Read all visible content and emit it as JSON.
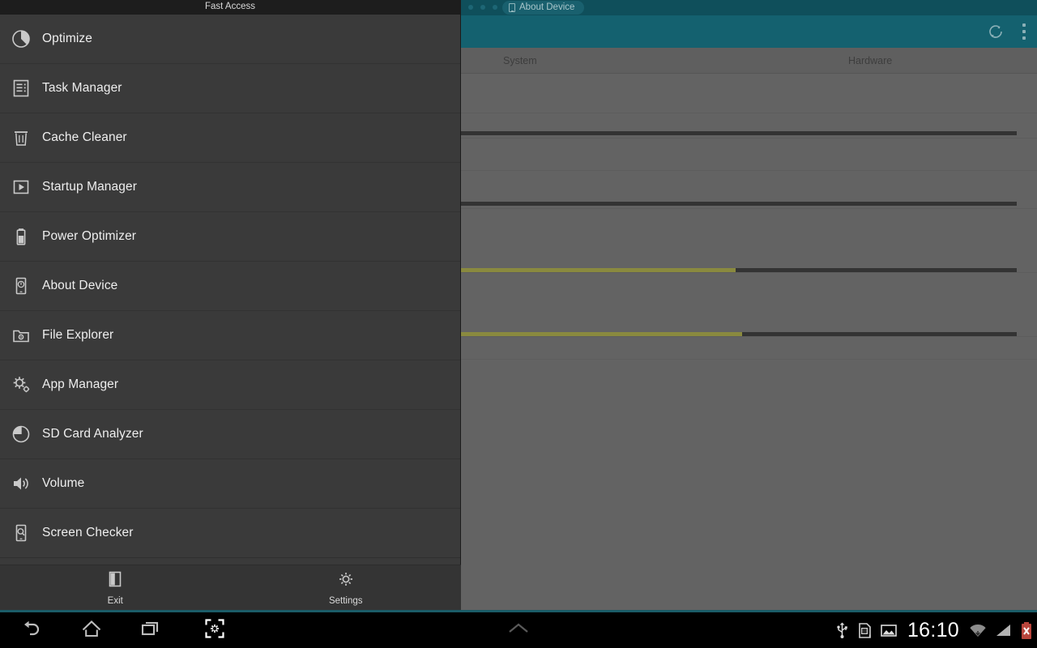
{
  "app": {
    "window_tab": {
      "label": "About Device",
      "icon": "phone-icon"
    },
    "actionbar": {
      "refresh_icon": "refresh-icon",
      "overflow_icon": "overflow-menu-icon"
    },
    "tabs": [
      {
        "label": "System",
        "selected": true
      },
      {
        "label": "Hardware",
        "selected": false
      }
    ],
    "rows": [
      {
        "bar": false
      },
      {
        "bar": true,
        "fill_percent": 0
      },
      {
        "bar": false
      },
      {
        "bar": true,
        "fill_percent": 0
      },
      {
        "bar": true,
        "fill_percent": 49
      },
      {
        "bar": true,
        "fill_percent": 51
      },
      {
        "bar": false
      }
    ],
    "colors": {
      "actionbar": "#14616f",
      "tabstrip": "#0f4f5b",
      "content": "#636363",
      "bar_track": "#333333",
      "bar_fill": "#8a8a3f"
    }
  },
  "fast_access": {
    "title": "Fast Access",
    "items": [
      {
        "label": "Optimize",
        "icon": "pie-gauge-icon"
      },
      {
        "label": "Task Manager",
        "icon": "list-document-icon"
      },
      {
        "label": "Cache Cleaner",
        "icon": "trash-icon"
      },
      {
        "label": "Startup Manager",
        "icon": "play-box-icon"
      },
      {
        "label": "Power Optimizer",
        "icon": "battery-icon"
      },
      {
        "label": "About Device",
        "icon": "phone-info-icon"
      },
      {
        "label": "File Explorer",
        "icon": "folder-gear-icon"
      },
      {
        "label": "App Manager",
        "icon": "gears-icon"
      },
      {
        "label": "SD Card Analyzer",
        "icon": "pie-chart-icon"
      },
      {
        "label": "Volume",
        "icon": "speaker-icon"
      },
      {
        "label": "Screen Checker",
        "icon": "phone-search-icon"
      }
    ],
    "buttons": [
      {
        "label": "Exit",
        "icon": "exit-door-icon"
      },
      {
        "label": "Settings",
        "icon": "gear-icon"
      }
    ]
  },
  "navbar": {
    "buttons": [
      {
        "name": "back",
        "icon": "back-arrow-icon"
      },
      {
        "name": "home",
        "icon": "home-icon"
      },
      {
        "name": "recents",
        "icon": "recent-apps-icon"
      },
      {
        "name": "screenshot",
        "icon": "screenshot-icon"
      }
    ],
    "handle_icon": "chevron-up-icon"
  },
  "statusbar": {
    "clock": "16:10",
    "icons": [
      "usb-icon",
      "sd-card-icon",
      "screenshot-image-icon",
      "wifi-icon",
      "cellular-signal-icon",
      "battery-error-icon"
    ]
  }
}
